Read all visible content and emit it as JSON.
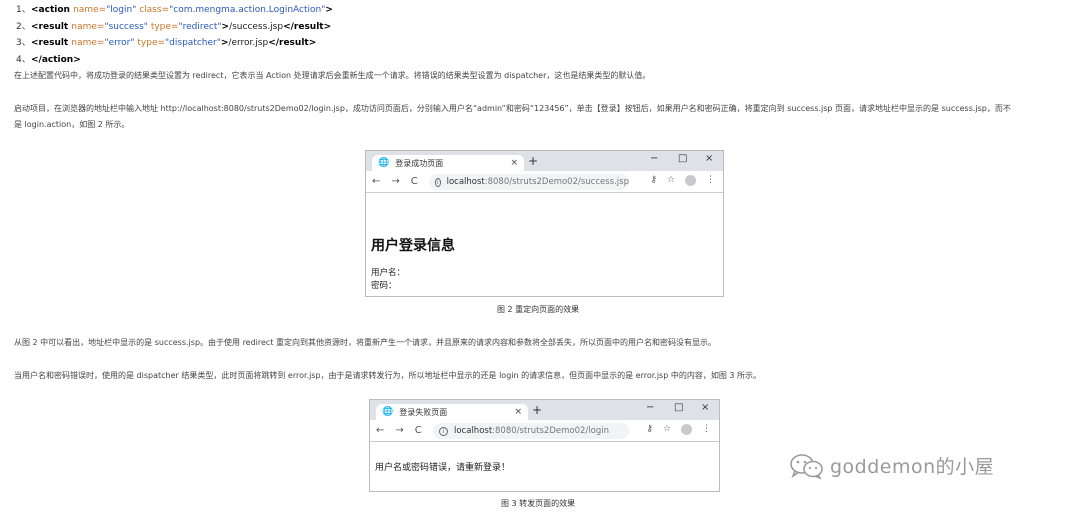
{
  "code_lines": [
    {
      "num": "1、",
      "parts": [
        [
          "tag",
          "<action "
        ],
        [
          "attr",
          "name="
        ],
        [
          "val",
          "\"login\" "
        ],
        [
          "attr",
          "class="
        ],
        [
          "val",
          "\"com.mengma.action.LoginAction\""
        ],
        [
          "tag",
          ">"
        ]
      ]
    },
    {
      "num": "2、",
      "parts": [
        [
          "tag",
          "<result "
        ],
        [
          "attr",
          "name="
        ],
        [
          "val",
          "\"success\" "
        ],
        [
          "attr",
          "type="
        ],
        [
          "val",
          "\"redirect\""
        ],
        [
          "tag",
          ">"
        ],
        [
          "txt",
          "/success.jsp"
        ],
        [
          "tag",
          "</result>"
        ]
      ]
    },
    {
      "num": "3、",
      "parts": [
        [
          "tag",
          "<result "
        ],
        [
          "attr",
          "name="
        ],
        [
          "val",
          "\"error\" "
        ],
        [
          "attr",
          "type="
        ],
        [
          "val",
          "\"dispatcher\""
        ],
        [
          "tag",
          ">"
        ],
        [
          "txt",
          "/error.jsp"
        ],
        [
          "tag",
          "</result>"
        ]
      ]
    },
    {
      "num": "4、",
      "parts": [
        [
          "tag",
          "</action>"
        ]
      ]
    }
  ],
  "paragraphs": {
    "p1": "在上述配置代码中，将成功登录的结果类型设置为 redirect，它表示当 Action 处理请求后会重新生成一个请求。将错误的结果类型设置为 dispatcher，这也是结果类型的默认值。",
    "p2a": "启动项目，在浏览器的地址栏中输入地址 http://localhost:8080/struts2Demo02/login.jsp，成功访问页面后，分别输入用户名“admin”和密码“123456”，单击【登录】按钮后，如果用户名和密码正确，将重定向到 success.jsp 页面，请求地址栏中显示的是 success.jsp，而不",
    "p2b": "是 login.action，如图 2 所示。",
    "p3": "从图 2 中可以看出，地址栏中显示的是 success.jsp。由于使用 redirect 重定向到其他资源时，将重新产生一个请求，并且原来的请求内容和参数将全部丢失，所以页面中的用户名和密码没有显示。",
    "p4": "当用户名和密码错误时，使用的是 dispatcher 结果类型，此时页面将跳转到 error.jsp，由于是请求转发行为，所以地址栏中显示的还是 login 的请求信息，但页面中显示的是 error.jsp 中的内容，如图 3 所示。"
  },
  "browser1": {
    "tab_title": "登录成功页面",
    "url_host": "localhost",
    "url_path": ":8080/struts2Demo02/success.jsp",
    "heading": "用户登录信息",
    "line1": "用户名：",
    "line2": "密码："
  },
  "caption1": "图 2  重定向页面的效果",
  "browser2": {
    "tab_title": "登录失败页面",
    "url_host": "localhost",
    "url_path": ":8080/struts2Demo02/login",
    "message": "用户名或密码错误，请重新登录！"
  },
  "caption2": "图 3  转发页面的效果",
  "watermark": "goddemon的小屋",
  "icons": {
    "tab_icon": "globe-icon",
    "close": "×",
    "new_tab": "+",
    "minimize": "−",
    "maximize": "□",
    "back": "←",
    "forward": "→",
    "reload": "C",
    "key": "⚷",
    "star": "☆",
    "menu": "⋮"
  }
}
